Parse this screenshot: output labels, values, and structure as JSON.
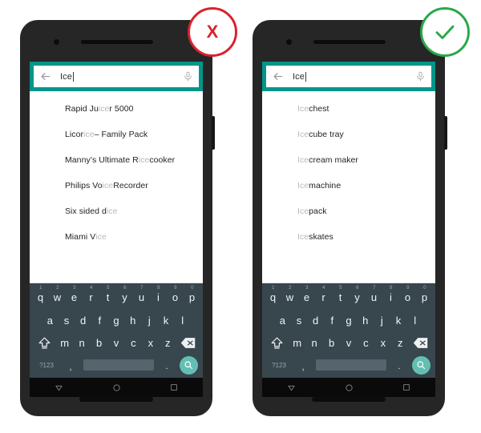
{
  "search": {
    "query": "Ice",
    "back_icon": "back-arrow-icon",
    "mic_icon": "microphone-icon",
    "accent_color": "#00968a"
  },
  "phones": [
    {
      "id": "left",
      "badge": {
        "type": "fail",
        "glyph": "X",
        "color": "#d8232f"
      },
      "suggestions": [
        {
          "parts": [
            {
              "t": "Rapid Ju",
              "m": false
            },
            {
              "t": "ice",
              "m": true
            },
            {
              "t": "r 5000",
              "m": false
            }
          ]
        },
        {
          "parts": [
            {
              "t": "Licor",
              "m": false
            },
            {
              "t": "ice",
              "m": true
            },
            {
              "t": " – Family Pack",
              "m": false
            }
          ]
        },
        {
          "parts": [
            {
              "t": "Manny’s Ultimate R",
              "m": false
            },
            {
              "t": "ice",
              "m": true
            },
            {
              "t": " cooker",
              "m": false
            }
          ]
        },
        {
          "parts": [
            {
              "t": "Philips Vo",
              "m": false
            },
            {
              "t": "ice",
              "m": true
            },
            {
              "t": " Recorder",
              "m": false
            }
          ]
        },
        {
          "parts": [
            {
              "t": "Six sided d",
              "m": false
            },
            {
              "t": "ice",
              "m": true
            }
          ]
        },
        {
          "parts": [
            {
              "t": "Miami V",
              "m": false
            },
            {
              "t": "ice",
              "m": true
            }
          ]
        }
      ]
    },
    {
      "id": "right",
      "badge": {
        "type": "pass",
        "glyph": "✓",
        "color": "#2aa84a"
      },
      "suggestions": [
        {
          "parts": [
            {
              "t": "Ice",
              "m": true
            },
            {
              "t": " chest",
              "m": false
            }
          ]
        },
        {
          "parts": [
            {
              "t": "Ice",
              "m": true
            },
            {
              "t": " cube tray",
              "m": false
            }
          ]
        },
        {
          "parts": [
            {
              "t": "Ice",
              "m": true
            },
            {
              "t": " cream maker",
              "m": false
            }
          ]
        },
        {
          "parts": [
            {
              "t": "Ice",
              "m": true
            },
            {
              "t": " machine",
              "m": false
            }
          ]
        },
        {
          "parts": [
            {
              "t": "Ice",
              "m": true
            },
            {
              "t": " pack",
              "m": false
            }
          ]
        },
        {
          "parts": [
            {
              "t": "Ice",
              "m": true
            },
            {
              "t": " skates",
              "m": false
            }
          ]
        }
      ]
    }
  ],
  "keyboard": {
    "row1": [
      {
        "key": "q",
        "num": "1"
      },
      {
        "key": "w",
        "num": "2"
      },
      {
        "key": "e",
        "num": "3"
      },
      {
        "key": "r",
        "num": "4"
      },
      {
        "key": "t",
        "num": "5"
      },
      {
        "key": "y",
        "num": "6"
      },
      {
        "key": "u",
        "num": "7"
      },
      {
        "key": "i",
        "num": "8"
      },
      {
        "key": "o",
        "num": "9"
      },
      {
        "key": "p",
        "num": "0"
      }
    ],
    "row2": [
      "a",
      "s",
      "d",
      "f",
      "g",
      "h",
      "j",
      "k",
      "l"
    ],
    "row3": [
      "z",
      "x",
      "c",
      "v",
      "b",
      "n",
      "m"
    ],
    "shift_icon": "shift-key-icon",
    "delete_icon": "backspace-key-icon",
    "symbols_label": "?123",
    "comma_label": ",",
    "period_label": ".",
    "space_label": "",
    "search_icon": "search-key-icon",
    "search_key_color": "#63bfb3",
    "background_color": "#38464e"
  },
  "navbar": {
    "back_icon": "nav-back-triangle-icon",
    "home_icon": "nav-home-circle-icon",
    "recents_icon": "nav-recents-square-icon"
  }
}
